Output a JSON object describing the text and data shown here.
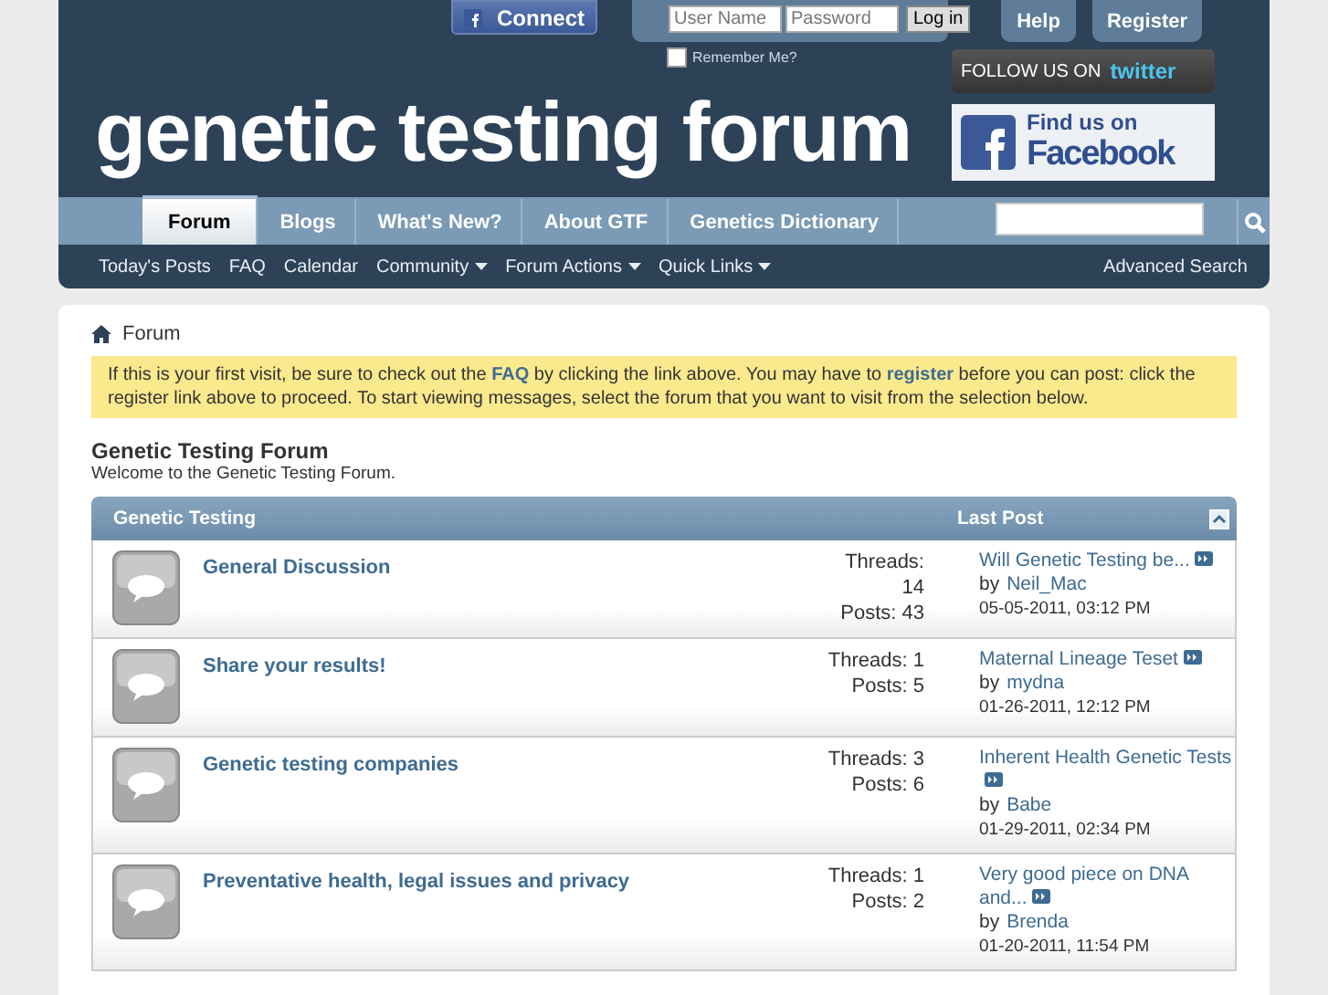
{
  "header": {
    "fb_connect": "Connect",
    "login": {
      "username_placeholder": "User Name",
      "password_placeholder": "Password",
      "button": "Log in",
      "remember": "Remember Me?",
      "remember_checked": false
    },
    "help": "Help",
    "register": "Register",
    "logo": "genetic testing forum",
    "twitter": {
      "label": "FOLLOW US ON",
      "brand": "twitter"
    },
    "facebook": {
      "line1": "Find us on",
      "line2": "Facebook"
    }
  },
  "nav": {
    "tabs": [
      {
        "label": "Forum",
        "selected": true
      },
      {
        "label": "Blogs",
        "selected": false
      },
      {
        "label": "What's New?",
        "selected": false
      },
      {
        "label": "About GTF",
        "selected": false
      },
      {
        "label": "Genetics Dictionary",
        "selected": false
      }
    ],
    "sublinks": [
      {
        "label": "Today's Posts",
        "menu": false
      },
      {
        "label": "FAQ",
        "menu": false
      },
      {
        "label": "Calendar",
        "menu": false
      },
      {
        "label": "Community",
        "menu": true
      },
      {
        "label": "Forum Actions",
        "menu": true
      },
      {
        "label": "Quick Links",
        "menu": true
      }
    ],
    "advanced_search": "Advanced Search"
  },
  "breadcrumb": "Forum",
  "notice": [
    {
      "kind": "text",
      "text": "If this is your first visit, be sure to check out the "
    },
    {
      "kind": "link",
      "text": "FAQ"
    },
    {
      "kind": "text",
      "text": " by clicking the link above. You may have to "
    },
    {
      "kind": "link",
      "text": "register"
    },
    {
      "kind": "text",
      "text": " before you can post: click the register link above to proceed. To start viewing messages, select the forum that you want to visit from the selection below."
    }
  ],
  "forum": {
    "title": "Genetic Testing Forum",
    "description": "Welcome to the Genetic Testing Forum.",
    "category": "Genetic Testing",
    "last_post_heading": "Last Post",
    "rows": [
      {
        "title": "General Discussion",
        "stats": [
          "Threads:",
          "14",
          "Posts: 43"
        ],
        "last_post": {
          "title": "Will Genetic Testing be...",
          "by": "by",
          "user": "Neil_Mac",
          "date": "05-05-2011, 03:12 PM"
        }
      },
      {
        "title": "Share your results!",
        "stats": [
          "Threads: 1",
          "Posts: 5"
        ],
        "last_post": {
          "title": "Maternal Lineage Teset",
          "by": "by",
          "user": "mydna",
          "date": "01-26-2011, 12:12 PM"
        }
      },
      {
        "title": "Genetic testing companies",
        "stats": [
          "Threads: 3",
          "Posts: 6"
        ],
        "last_post": {
          "title": "Inherent Health Genetic Tests",
          "by": "by",
          "user": "Babe",
          "date": "01-29-2011, 02:34 PM"
        }
      },
      {
        "title": "Preventative health, legal issues and privacy",
        "stats": [
          "Threads: 1",
          "Posts: 2"
        ],
        "last_post": {
          "title": "Very good piece on DNA and...",
          "by": "by",
          "user": "Brenda",
          "date": "01-20-2011, 11:54 PM"
        }
      }
    ]
  }
}
